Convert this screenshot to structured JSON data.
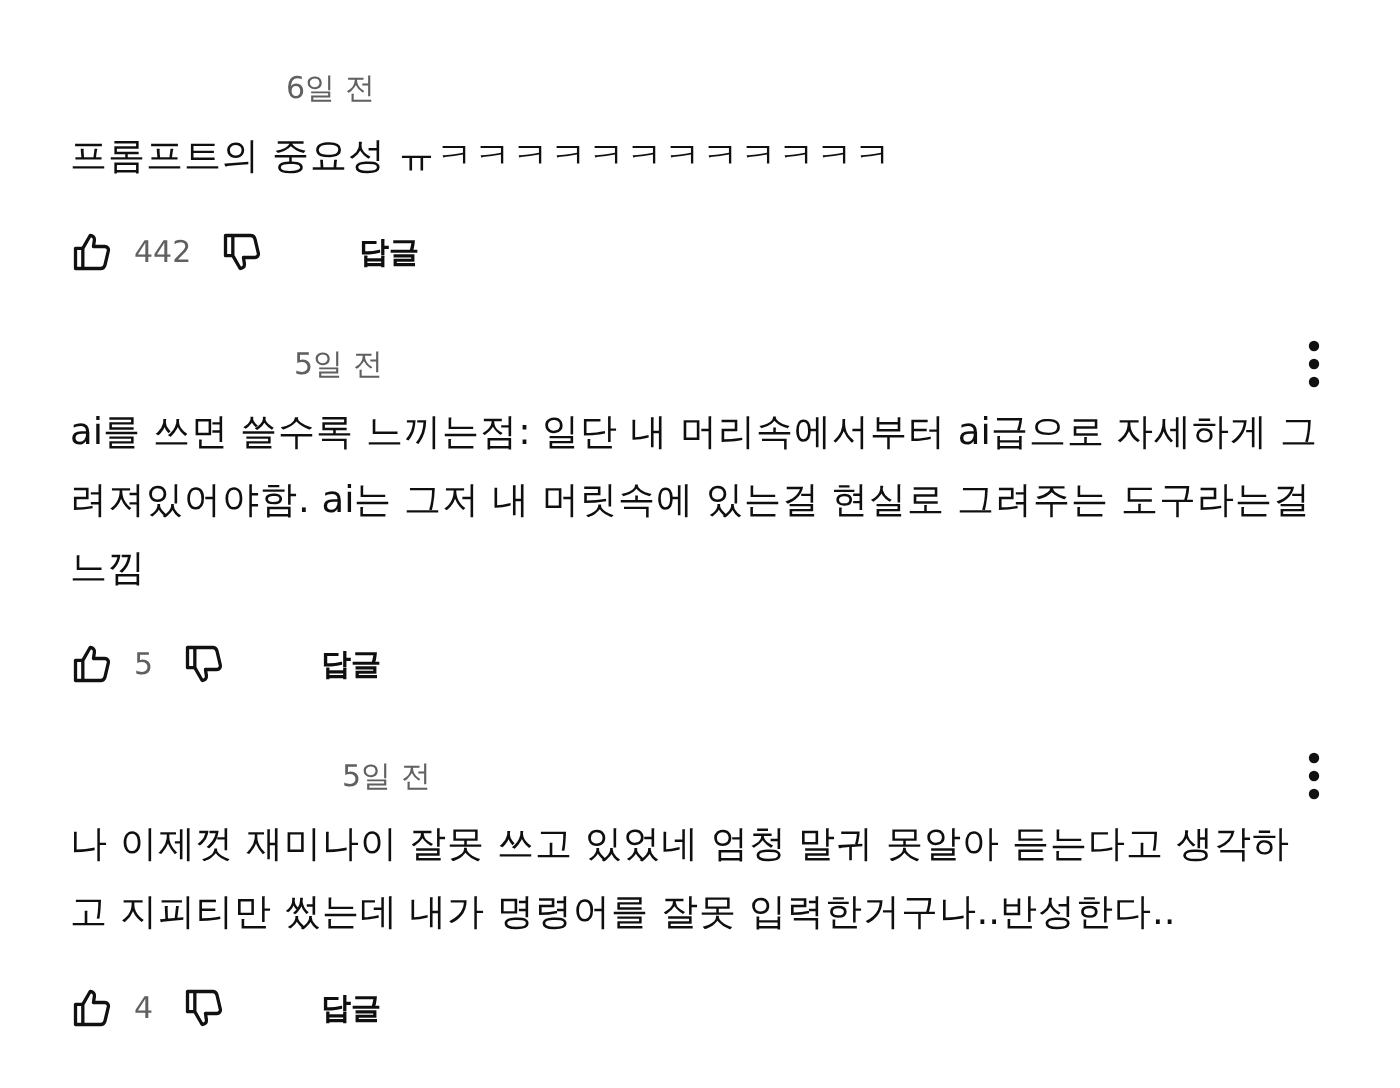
{
  "comments": [
    {
      "time": "6일 전",
      "text": "프롬프트의 중요성 ㅠㅋㅋㅋㅋㅋㅋㅋㅋㅋㅋㅋㅋ",
      "likes": "442",
      "reply": "답글",
      "menu": false
    },
    {
      "time": "5일 전",
      "text": "ai를 쓰면 쓸수록 느끼는점: 일단 내 머리속에서부터 ai급으로 자세하게 그려져있어야함. ai는 그저 내 머릿속에 있는걸 현실로 그려주는 도구라는걸 느낌",
      "likes": "5",
      "reply": "답글",
      "menu": true
    },
    {
      "time": "5일 전",
      "text": "나 이제껏 재미나이 잘못 쓰고 있었네 엄청 말귀 못알아 듣는다고 생각하고 지피티만 썼는데 내가 명령어를 잘못 입력한거구나..반성한다..",
      "likes": "4",
      "reply": "답글",
      "menu": true
    }
  ]
}
